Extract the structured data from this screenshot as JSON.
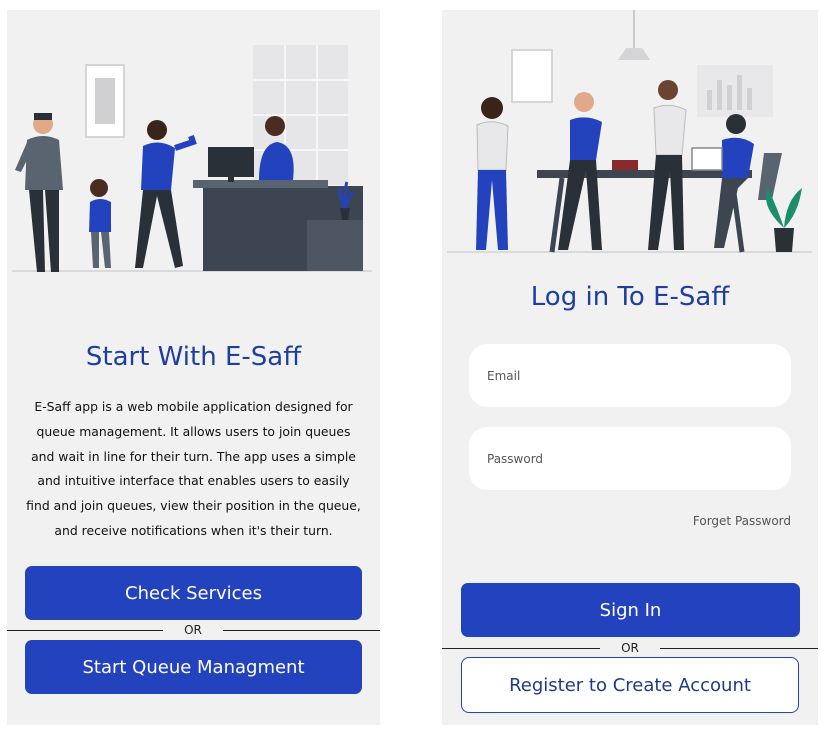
{
  "start_screen": {
    "title": "Start With E-Saff",
    "description": "E-Saff app is a web mobile application designed for queue management. It allows users to join queues and wait in line for their turn. The app uses a simple and intuitive interface that enables users to easily find and join queues, view their position in the queue, and receive notifications when it's their turn.",
    "check_services_label": "Check Services",
    "or_label": "OR",
    "start_queue_label": "Start Queue Managment"
  },
  "login_screen": {
    "title": "Log in To E-Saff",
    "email_placeholder": "Email",
    "password_placeholder": "Password",
    "forget_password_label": "Forget Password",
    "sign_in_label": "Sign In",
    "or_label": "OR",
    "register_label": "Register to Create Account"
  },
  "colors": {
    "accent": "#2342bd",
    "title": "#1f3f9f",
    "background": "#f1f1f2",
    "dark_grey": "#3d4650"
  },
  "icons": [
    "reception-illustration",
    "office-team-illustration"
  ]
}
